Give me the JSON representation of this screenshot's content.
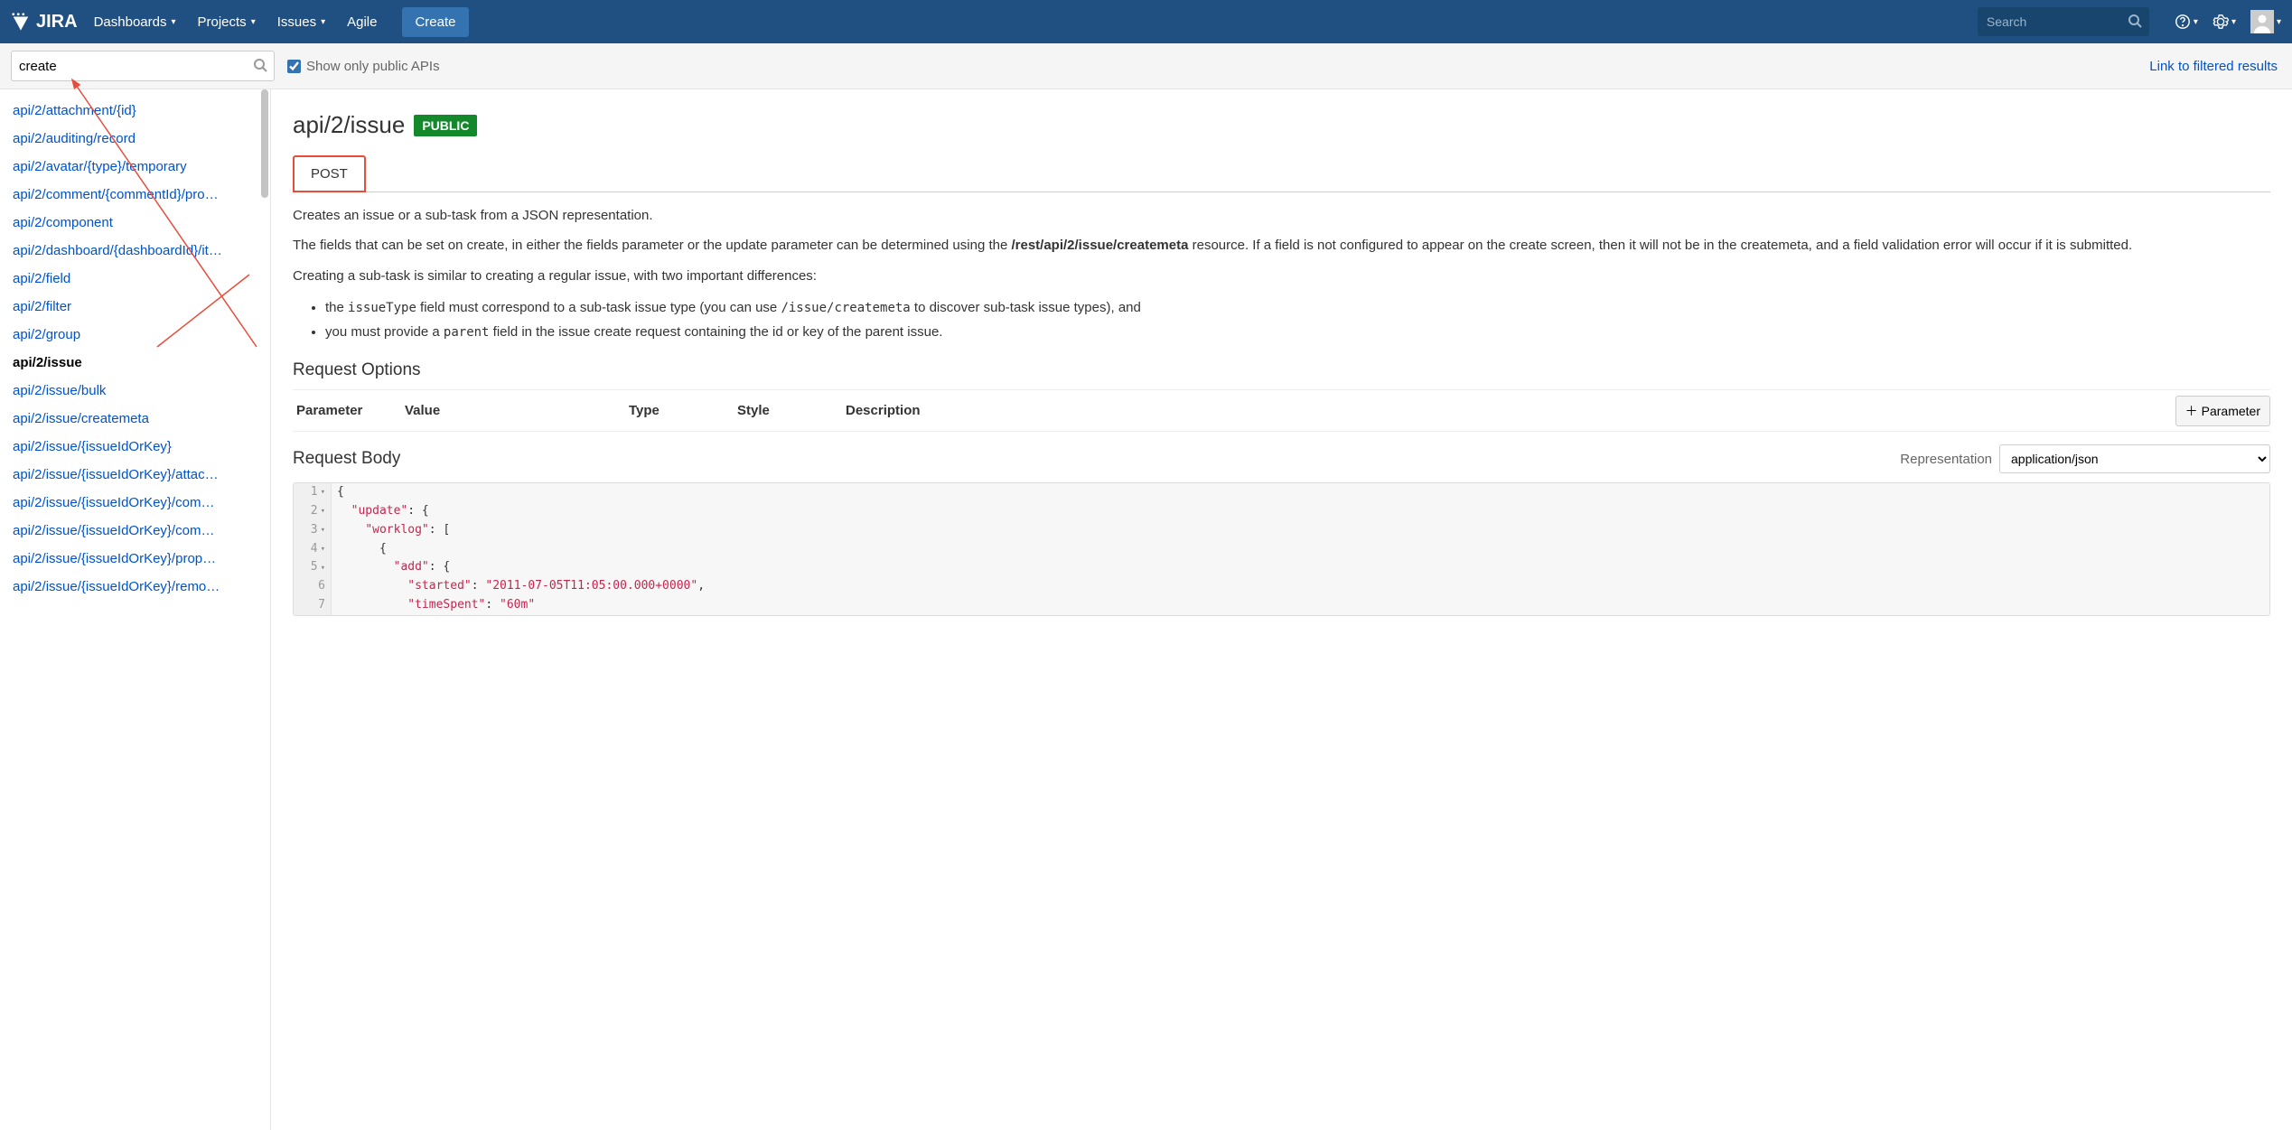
{
  "nav": {
    "logo": "JIRA",
    "items": [
      "Dashboards",
      "Projects",
      "Issues",
      "Agile"
    ],
    "create": "Create",
    "search_placeholder": "Search"
  },
  "toolbar": {
    "search_value": "create",
    "show_public_label": "Show only public APIs",
    "link_filtered": "Link to filtered results"
  },
  "sidebar": {
    "items": [
      "api/2/attachment/{id}",
      "api/2/auditing/record",
      "api/2/avatar/{type}/temporary",
      "api/2/comment/{commentId}/pro…",
      "api/2/component",
      "api/2/dashboard/{dashboardId}/it…",
      "api/2/field",
      "api/2/filter",
      "api/2/group",
      "api/2/issue",
      "api/2/issue/bulk",
      "api/2/issue/createmeta",
      "api/2/issue/{issueIdOrKey}",
      "api/2/issue/{issueIdOrKey}/attac…",
      "api/2/issue/{issueIdOrKey}/com…",
      "api/2/issue/{issueIdOrKey}/com…",
      "api/2/issue/{issueIdOrKey}/prop…",
      "api/2/issue/{issueIdOrKey}/remo…"
    ],
    "active_index": 9
  },
  "content": {
    "title": "api/2/issue",
    "badge": "PUBLIC",
    "tabs": {
      "post": "POST"
    },
    "desc": {
      "p1": "Creates an issue or a sub-task from a JSON representation.",
      "p2a": "The fields that can be set on create, in either the fields parameter or the update parameter can be determined using the ",
      "p2b": "/rest/api/2/issue/createmeta",
      "p2c": " resource. If a field is not configured to appear on the create screen, then it will not be in the createmeta, and a field validation error will occur if it is submitted.",
      "p3": "Creating a sub-task is similar to creating a regular issue, with two important differences:",
      "li1a": "the ",
      "li1b": "issueType",
      "li1c": " field must correspond to a sub-task issue type (you can use ",
      "li1d": "/issue/createmeta",
      "li1e": " to discover sub-task issue types), and",
      "li2a": "you must provide a ",
      "li2b": "parent",
      "li2c": " field in the issue create request containing the id or key of the parent issue."
    },
    "req_options": {
      "heading": "Request Options",
      "cols": [
        "Parameter",
        "Value",
        "Type",
        "Style",
        "Description"
      ],
      "add_btn": "Parameter"
    },
    "req_body": {
      "heading": "Request Body",
      "rep_label": "Representation",
      "rep_value": "application/json",
      "code_lines": [
        {
          "n": 1,
          "fold": true,
          "txt": "{"
        },
        {
          "n": 2,
          "fold": true,
          "txt": "  \"update\": {",
          "key": "update"
        },
        {
          "n": 3,
          "fold": true,
          "txt": "    \"worklog\": [",
          "key": "worklog"
        },
        {
          "n": 4,
          "fold": true,
          "txt": "      {"
        },
        {
          "n": 5,
          "fold": true,
          "txt": "        \"add\": {",
          "key": "add"
        },
        {
          "n": 6,
          "fold": false,
          "txt": "          \"started\": \"2011-07-05T11:05:00.000+0000\",",
          "key": "started",
          "val": "2011-07-05T11:05:00.000+0000"
        },
        {
          "n": 7,
          "fold": false,
          "txt": "          \"timeSpent\": \"60m\"",
          "key": "timeSpent",
          "val": "60m"
        }
      ]
    }
  }
}
